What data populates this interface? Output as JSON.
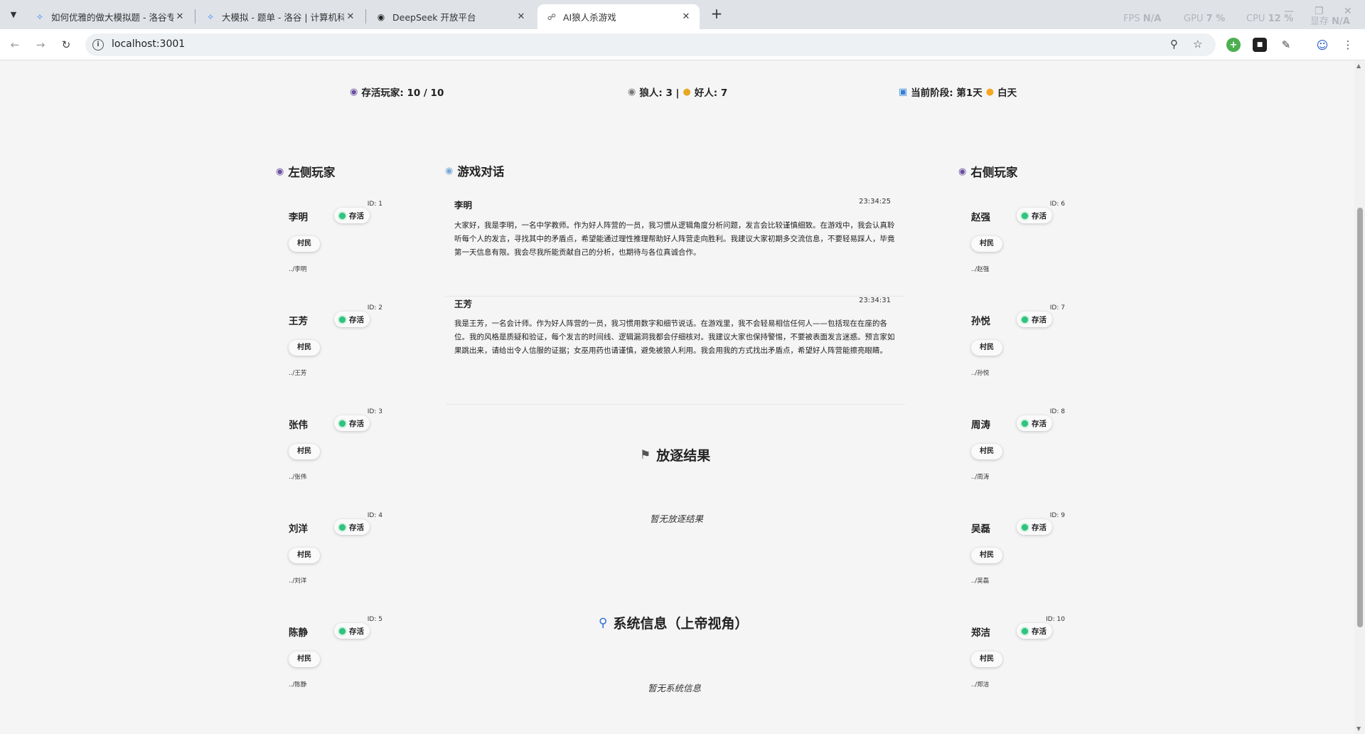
{
  "browser": {
    "tabs": [
      {
        "title": "如何优雅的做大模拟题 - 洛谷专栏",
        "icon": "luogu-icon"
      },
      {
        "title": "大模拟 - 题单 - 洛谷 | 计算机科学教育新生态",
        "icon": "luogu-icon"
      },
      {
        "title": "DeepSeek 开放平台",
        "icon": "deepseek-icon"
      },
      {
        "title": "AI狼人杀游戏",
        "icon": "globe-icon"
      }
    ],
    "perf": {
      "fps_label": "FPS",
      "fps": "N/A",
      "gpu_label": "GPU",
      "gpu": "7 %",
      "cpu_label": "CPU",
      "cpu": "12 %",
      "mem_label": "显存",
      "mem": "N/A"
    },
    "url": "localhost:3001"
  },
  "stats": {
    "alive": "存活玩家: 10 / 10",
    "camps": "狼人: 3 | ",
    "good": "好人: 7",
    "phase": "当前阶段: 第1天",
    "phase_day": "白天"
  },
  "left_title": "左侧玩家",
  "right_title": "右侧玩家",
  "dialog_title": "游戏对话",
  "players_left": [
    {
      "id": "ID: 1",
      "name": "李明",
      "status": "存活",
      "role": "村民",
      "img": "../李明"
    },
    {
      "id": "ID: 2",
      "name": "王芳",
      "status": "存活",
      "role": "村民",
      "img": "../王芳"
    },
    {
      "id": "ID: 3",
      "name": "张伟",
      "status": "存活",
      "role": "村民",
      "img": "../张伟"
    },
    {
      "id": "ID: 4",
      "name": "刘洋",
      "status": "存活",
      "role": "村民",
      "img": "../刘洋"
    },
    {
      "id": "ID: 5",
      "name": "陈静",
      "status": "存活",
      "role": "村民",
      "img": "../陈静"
    }
  ],
  "players_right": [
    {
      "id": "ID: 6",
      "name": "赵强",
      "status": "存活",
      "role": "村民",
      "img": "../赵强"
    },
    {
      "id": "ID: 7",
      "name": "孙悦",
      "status": "存活",
      "role": "村民",
      "img": "../孙悦"
    },
    {
      "id": "ID: 8",
      "name": "周涛",
      "status": "存活",
      "role": "村民",
      "img": "../周涛"
    },
    {
      "id": "ID: 9",
      "name": "吴磊",
      "status": "存活",
      "role": "村民",
      "img": "../吴磊"
    },
    {
      "id": "ID: 10",
      "name": "郑洁",
      "status": "存活",
      "role": "村民",
      "img": "../郑洁"
    }
  ],
  "messages": [
    {
      "name": "李明",
      "time": "23:34:25",
      "text": "大家好，我是李明，一名中学教师。作为好人阵营的一员，我习惯从逻辑角度分析问题，发言会比较谨慎细致。在游戏中，我会认真聆听每个人的发言，寻找其中的矛盾点，希望能通过理性推理帮助好人阵营走向胜利。我建议大家初期多交流信息，不要轻易踩人，毕竟第一天信息有限。我会尽我所能贡献自己的分析，也期待与各位真诚合作。"
    },
    {
      "name": "王芳",
      "time": "23:34:31",
      "text": "我是王芳，一名会计师。作为好人阵营的一员，我习惯用数字和细节说话。在游戏里，我不会轻易相信任何人——包括现在在座的各位。我的风格是质疑和验证，每个发言的时间线、逻辑漏洞我都会仔细核对。我建议大家也保持警惕，不要被表面发言迷惑。预言家如果跳出来，请给出令人信服的证据；女巫用药也请谨慎，避免被狼人利用。我会用我的方式找出矛盾点，希望好人阵营能擦亮眼睛。"
    }
  ],
  "exile": {
    "title": "放逐结果",
    "empty": "暂无放逐结果"
  },
  "system": {
    "title": "系统信息（上帝视角）",
    "empty": "暂无系统信息"
  }
}
